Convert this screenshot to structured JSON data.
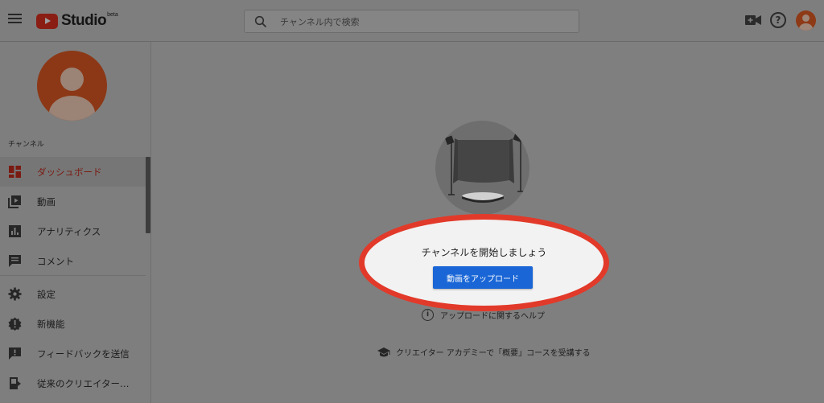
{
  "header": {
    "logo_text": "Studio",
    "logo_badge": "beta",
    "search_placeholder": "チャンネル内で検索"
  },
  "sidebar": {
    "section_label": "チャンネル",
    "items": [
      {
        "label": "ダッシュボード",
        "icon": "dashboard-icon",
        "active": true
      },
      {
        "label": "動画",
        "icon": "video-library-icon"
      },
      {
        "label": "アナリティクス",
        "icon": "analytics-icon"
      },
      {
        "label": "コメント",
        "icon": "comment-icon"
      },
      {
        "label": "設定",
        "icon": "settings-icon"
      },
      {
        "label": "新機能",
        "icon": "new-features-icon"
      },
      {
        "label": "フィードバックを送信",
        "icon": "feedback-icon"
      },
      {
        "label": "従来のクリエイター…",
        "icon": "classic-studio-icon"
      }
    ]
  },
  "main": {
    "start_text": "チャンネルを開始しましょう",
    "upload_button": "動画をアップロード",
    "help_link": "アップロードに関するヘルプ",
    "academy_link": "クリエイター アカデミーで「概要」コースを受講する"
  },
  "colors": {
    "accent_blue": "#1a66d6",
    "highlight_red": "#e23a2a",
    "active_red": "#7a1a11",
    "avatar_orange": "#8c3816"
  }
}
